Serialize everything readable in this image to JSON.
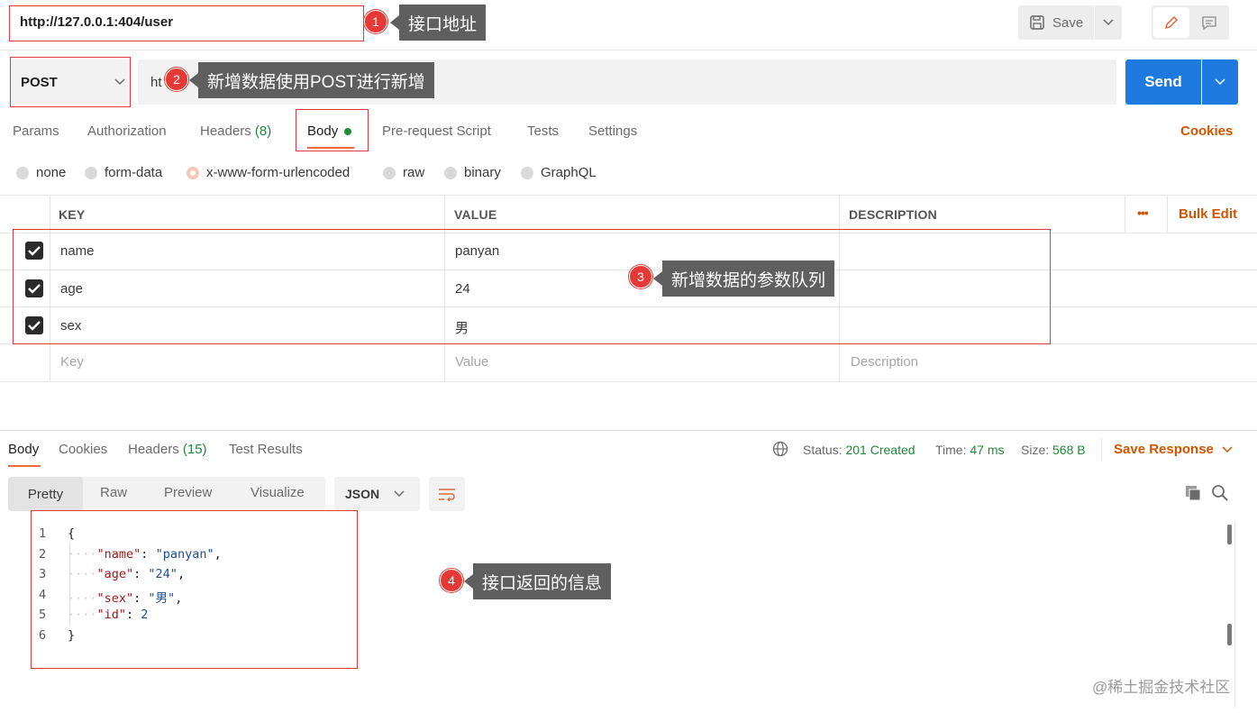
{
  "top": {
    "url": "http://127.0.0.1:404/user",
    "save_label": "Save"
  },
  "request": {
    "method": "POST",
    "url_partial": "ht",
    "send_label": "Send"
  },
  "request_tabs": [
    {
      "label": "Params"
    },
    {
      "label": "Authorization"
    },
    {
      "label": "Headers",
      "count": "(8)"
    },
    {
      "label": "Body"
    },
    {
      "label": "Pre-request Script"
    },
    {
      "label": "Tests"
    },
    {
      "label": "Settings"
    }
  ],
  "cookies_label": "Cookies",
  "body_types": [
    {
      "label": "none"
    },
    {
      "label": "form-data"
    },
    {
      "label": "x-www-form-urlencoded"
    },
    {
      "label": "raw"
    },
    {
      "label": "binary"
    },
    {
      "label": "GraphQL"
    }
  ],
  "table": {
    "headers": {
      "key": "KEY",
      "value": "VALUE",
      "description": "DESCRIPTION",
      "more": "•••",
      "bulk_edit": "Bulk Edit"
    },
    "rows": [
      {
        "key": "name",
        "value": "panyan",
        "checked": true
      },
      {
        "key": "age",
        "value": "24",
        "checked": true
      },
      {
        "key": "sex",
        "value": "男",
        "checked": true
      }
    ],
    "placeholders": {
      "key": "Key",
      "value": "Value",
      "description": "Description"
    }
  },
  "response": {
    "tabs": [
      {
        "label": "Body"
      },
      {
        "label": "Cookies"
      },
      {
        "label": "Headers",
        "count": "(15)"
      },
      {
        "label": "Test Results"
      }
    ],
    "status_label": "Status:",
    "status_value": "201 Created",
    "time_label": "Time:",
    "time_value": "47 ms",
    "size_label": "Size:",
    "size_value": "568 B",
    "save_response": "Save Response",
    "view_tabs": [
      {
        "label": "Pretty"
      },
      {
        "label": "Raw"
      },
      {
        "label": "Preview"
      },
      {
        "label": "Visualize"
      }
    ],
    "format": "JSON",
    "code_lines": [
      {
        "n": "1",
        "text": "{"
      },
      {
        "n": "2",
        "key": "\"name\"",
        "val": "\"panyan\"",
        "comma": ","
      },
      {
        "n": "3",
        "key": "\"age\"",
        "val": "\"24\"",
        "comma": ","
      },
      {
        "n": "4",
        "key": "\"sex\"",
        "val": "\"男\"",
        "comma": ","
      },
      {
        "n": "5",
        "key": "\"id\"",
        "val": "2",
        "comma": ""
      },
      {
        "n": "6",
        "text": "}"
      }
    ]
  },
  "annotations": [
    {
      "num": "1",
      "text": "接口地址"
    },
    {
      "num": "2",
      "text": "新增数据使用POST进行新增"
    },
    {
      "num": "3",
      "text": "新增数据的参数队列"
    },
    {
      "num": "4",
      "text": "接口返回的信息"
    }
  ],
  "watermark": "@稀土掘金技术社区"
}
